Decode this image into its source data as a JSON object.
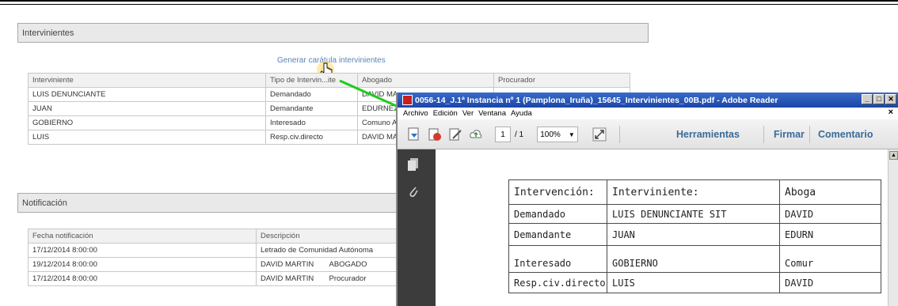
{
  "intervinientes_section": {
    "title": "Intervinientes",
    "generate_link": "Generar carátula intervinientes",
    "table": {
      "headers": [
        "Interviniente",
        "Tipo de Intervin...ite",
        "Abogado",
        "Procurador"
      ],
      "rows": [
        [
          "LUIS DENUNCIANTE",
          "Demandado",
          "DAVID MA",
          ""
        ],
        [
          "JUAN",
          "Demandante",
          "EDURNE",
          ""
        ],
        [
          "GOBIERNO",
          "Interesado",
          "Comuno A",
          ""
        ],
        [
          "LUIS",
          "Resp.civ.directo",
          "DAVID MA",
          ""
        ]
      ]
    }
  },
  "notificacion_section": {
    "title": "Notificación",
    "table": {
      "headers": [
        "Fecha notificación",
        "Descripción"
      ],
      "rows": [
        [
          "17/12/2014 8:00:00",
          "Letrado de Comunidad Autónoma",
          ""
        ],
        [
          "19/12/2014 8:00:00",
          "DAVID MARTIN",
          "ABOGADO"
        ],
        [
          "17/12/2014 8:00:00",
          "DAVID MARTIN",
          "Procurador"
        ]
      ]
    }
  },
  "adobe_window": {
    "title": "0056-14_J.1ª Instancia nº 1 (Pamplona_Iruña)_15645_Intervinientes_00B.pdf - Adobe Reader",
    "menu": [
      "Archivo",
      "Edición",
      "Ver",
      "Ventana",
      "Ayuda"
    ],
    "menu_close": "×",
    "toolbar": {
      "page_current": "1",
      "page_total": "/ 1",
      "zoom": "100%",
      "herramientas": "Herramientas",
      "firmar": "Firmar",
      "comentario": "Comentario"
    },
    "pdf_table": {
      "headers": [
        "Intervención:",
        "Interviniente:",
        "Aboga"
      ],
      "rows": [
        [
          "Demandado",
          "LUIS DENUNCIANTE SIT",
          "DAVID"
        ],
        [
          "Demandante",
          "JUAN",
          "EDURN"
        ],
        [
          "Interesado",
          "GOBIERNO",
          "Comur"
        ],
        [
          "Resp.civ.directo",
          "LUIS",
          "DAVID"
        ]
      ]
    }
  },
  "colors": {
    "link": "#5a84b4",
    "arrow": "#1ecb1e",
    "adobe_title": "#1a46a8",
    "toolbar_text": "#3a6a98"
  }
}
